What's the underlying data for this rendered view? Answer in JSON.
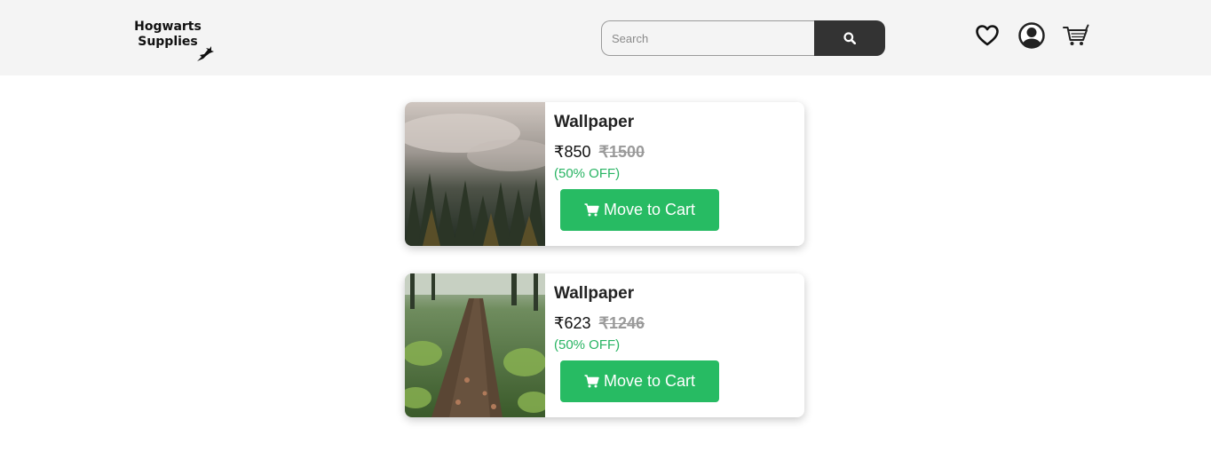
{
  "header": {
    "logo_line1": "Hogwarts",
    "logo_line2": "Supplies",
    "search_placeholder": "Search",
    "icons": [
      "heart-icon",
      "user-icon",
      "cart-icon"
    ]
  },
  "cards": [
    {
      "title": "Wallpaper",
      "price": "₹850",
      "old_price": "₹1500",
      "discount": "(50% OFF)",
      "button": "Move to Cart",
      "image": "misty-forest"
    },
    {
      "title": "Wallpaper",
      "price": "₹623",
      "old_price": "₹1246",
      "discount": "(50% OFF)",
      "button": "Move to Cart",
      "image": "forest-path"
    }
  ],
  "colors": {
    "accent_green": "#27bb63",
    "discount_green": "#28b463",
    "search_button": "#333333",
    "navbar_bg": "#f4f4f4"
  }
}
